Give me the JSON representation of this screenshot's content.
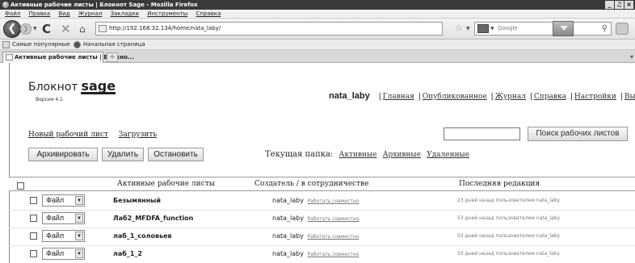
{
  "window": {
    "title": "Активные рабочие листы | Блокнот Sage - Mozilla Firefox",
    "controls": [
      "_",
      "♫",
      "×"
    ]
  },
  "menu": [
    "Файл",
    "Правка",
    "Вид",
    "Журнал",
    "Закладки",
    "Инструменты",
    "Справка"
  ],
  "nav": {
    "url": "http://192.168.32.134/home/nata_laby/",
    "search_placeholder": "Google"
  },
  "bookmarks": [
    "Самые популярные",
    "Начальная страница"
  ],
  "tab": {
    "label": "Активные рабочие листы | Блокно...",
    "close": "×",
    "new": "+"
  },
  "app": {
    "logo_text": "Блокнот",
    "logo_brand": "sage",
    "version": "Версия 4.1",
    "user": "nata_laby",
    "links": [
      "Главная",
      "Опубликованное",
      "Журнал",
      "Справка",
      "Настройки",
      "Выход"
    ]
  },
  "actions": {
    "new_worksheet": "Новый рабочий лист",
    "upload": "Загрузить",
    "search_button": "Поиск рабочих листов",
    "archive": "Архивировать",
    "delete": "Удалить",
    "stop": "Остановить"
  },
  "folder": {
    "label": "Текущая папка:",
    "active": "Активные",
    "archived": "Архивные",
    "deleted": "Удаленные"
  },
  "table": {
    "headers": [
      "Активные рабочие листы",
      "Создатель / в сотрудничестве",
      "Последняя редакция"
    ],
    "file_label": "Файл",
    "share_link": "Работать совместно",
    "rows": [
      {
        "name": "Безымянный",
        "owner": "nata_laby",
        "edited": "23 дней назад пользователем nata_laby"
      },
      {
        "name": "Лаб2_MFDFA_function",
        "owner": "nata_laby",
        "edited": "53 дней назад пользователем nata_laby"
      },
      {
        "name": "лаб_1_соловьев",
        "owner": "nata_laby",
        "edited": "53 дней назад пользователем nata_laby"
      },
      {
        "name": "лаб_1_2",
        "owner": "nata_laby",
        "edited": "53 дней назад пользователем nata_laby"
      }
    ]
  }
}
